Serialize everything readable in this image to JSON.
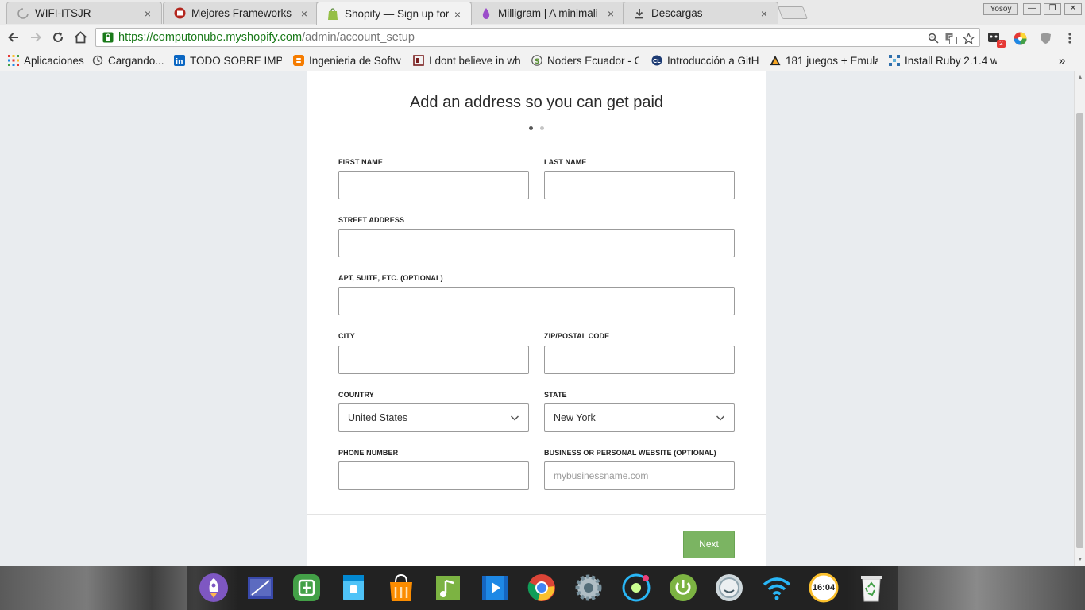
{
  "browser": {
    "tabs": [
      {
        "label": "WIFI-ITSJR",
        "icon": "loading-spinner-icon",
        "active": false
      },
      {
        "label": "Mejores Frameworks C",
        "icon": "site-favicon-icon",
        "active": false
      },
      {
        "label": "Shopify — Sign up for",
        "icon": "shopify-bag-icon",
        "active": true
      },
      {
        "label": "Milligram | A minimali",
        "icon": "milligram-drop-icon",
        "active": false
      },
      {
        "label": "Descargas",
        "icon": "download-icon",
        "active": false
      }
    ],
    "tab_close_glyph": "×",
    "profile_name": "Yosoy",
    "window_buttons": [
      "—",
      "❐",
      "✕"
    ],
    "url": {
      "scheme": "https://",
      "host": "computonube.myshopify.com",
      "path": "/admin/account_setup"
    },
    "extension_badge": "2",
    "bookmarks": [
      {
        "label": "Aplicaciones",
        "icon": "apps-grid-icon"
      },
      {
        "label": "Cargando...",
        "icon": "history-icon"
      },
      {
        "label": "TODO SOBRE IMPR",
        "icon": "linkedin-icon"
      },
      {
        "label": "Ingenieria de Softw",
        "icon": "blogger-icon"
      },
      {
        "label": "I dont believe in wh",
        "icon": "bookmark-page-icon"
      },
      {
        "label": "Noders Ecuador - C",
        "icon": "noders-icon"
      },
      {
        "label": "Introducción a GitH",
        "icon": "codeland-icon"
      },
      {
        "label": "181 juegos + Emula",
        "icon": "warning-triangle-icon"
      },
      {
        "label": "Install Ruby 2.1.4 w",
        "icon": "ruby-grid-icon"
      }
    ],
    "bookmarks_overflow": "»"
  },
  "form": {
    "heading": "Add an address so you can get paid",
    "step_indicator": {
      "current": 1,
      "total": 2
    },
    "fields": {
      "first_name": {
        "label": "FIRST NAME",
        "value": ""
      },
      "last_name": {
        "label": "LAST NAME",
        "value": ""
      },
      "street_address": {
        "label": "STREET ADDRESS",
        "value": ""
      },
      "apt": {
        "label": "APT, SUITE, ETC. (OPTIONAL)",
        "value": ""
      },
      "city": {
        "label": "CITY",
        "value": ""
      },
      "zip": {
        "label": "ZIP/POSTAL CODE",
        "value": ""
      },
      "country": {
        "label": "COUNTRY",
        "value": "United States"
      },
      "state": {
        "label": "STATE",
        "value": "New York"
      },
      "phone": {
        "label": "PHONE NUMBER",
        "value": ""
      },
      "website": {
        "label": "BUSINESS OR PERSONAL WEBSITE (OPTIONAL)",
        "value": "",
        "placeholder": "mybusinessname.com"
      }
    },
    "next_label": "Next"
  },
  "dock": {
    "items": [
      "rocket-launcher-icon",
      "screenshot-tool-icon",
      "app-store-icon",
      "file-manager-icon",
      "store-bag-icon",
      "music-player-icon",
      "video-player-icon",
      "chrome-icon",
      "settings-gear-icon",
      "camera-icon",
      "screen-recorder-icon",
      "power-icon",
      "finder-icon",
      "wifi-icon",
      "clock-icon",
      "trash-icon"
    ],
    "clock_text": "16:04"
  },
  "colors": {
    "accent_green": "#7bb462",
    "url_green": "#1a7a1a",
    "page_bg": "#e9ecef"
  }
}
